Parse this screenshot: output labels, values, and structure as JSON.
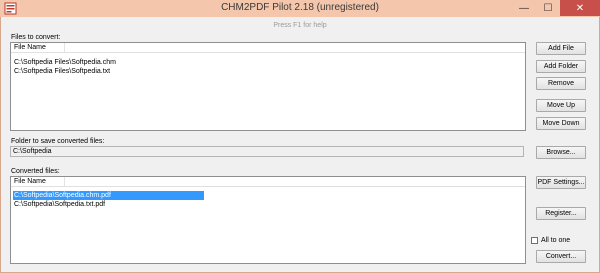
{
  "window": {
    "title": "CHM2PDF Pilot 2.18 (unregistered)",
    "minimize_glyph": "—",
    "maximize_glyph": "☐",
    "close_glyph": "✕"
  },
  "hint": "Press F1 for help",
  "files_to_convert": {
    "label": "Files to convert:",
    "column_header": "File Name",
    "items": [
      "C:\\Softpedia Files\\Softpedia.chm",
      "C:\\Softpedia Files\\Softpedia.txt"
    ]
  },
  "buttons": {
    "add_file": "Add File",
    "add_folder": "Add Folder",
    "remove": "Remove",
    "move_up": "Move Up",
    "move_down": "Move Down",
    "browse": "Browse...",
    "pdf_settings": "PDF Settings...",
    "register": "Register...",
    "convert": "Convert..."
  },
  "folder": {
    "label": "Folder to save converted files:",
    "value": "C:\\Softpedia"
  },
  "converted_files": {
    "label": "Converted files:",
    "column_header": "File Name",
    "items": [
      "C:\\Softpedia\\Softpedia.chm.pdf",
      "C:\\Softpedia\\Softpedia.txt.pdf"
    ],
    "selected_index": 0
  },
  "all_to_one": {
    "label": "All to one",
    "checked": false
  },
  "colors": {
    "titlebar": "#f4c6ac",
    "close_button": "#c7504a",
    "selection": "#3399ff"
  }
}
